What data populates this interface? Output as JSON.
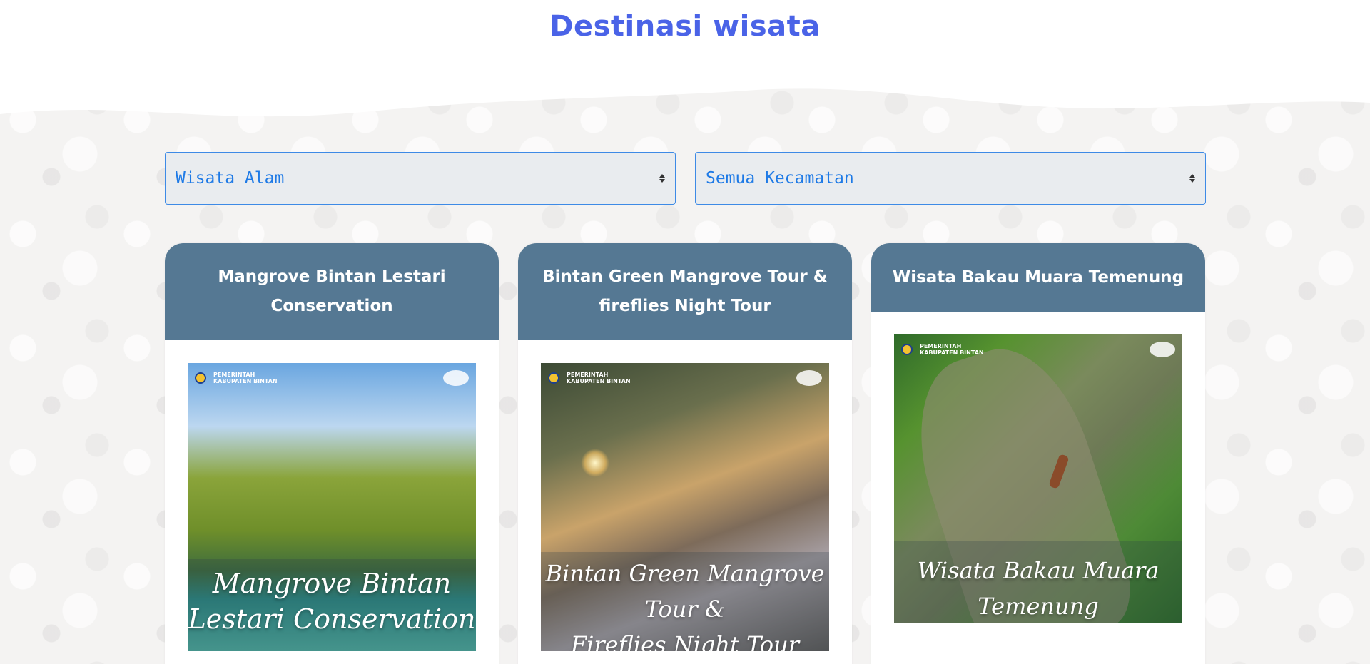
{
  "page": {
    "title": "Destinasi wisata"
  },
  "filters": {
    "category": {
      "selected": "Wisata Alam"
    },
    "district": {
      "selected": "Semua Kecamatan"
    }
  },
  "logo_strip": {
    "org_line1": "PEMERINTAH",
    "org_line2": "KABUPATEN BINTAN"
  },
  "cards": [
    {
      "title": "Mangrove Bintan Lestari Conservation",
      "image_caption_line1": "Mangrove Bintan",
      "image_caption_line2": "Lestari Conservation"
    },
    {
      "title": "Bintan Green Mangrove Tour & fireflies Night Tour",
      "image_caption_line1": "Bintan Green Mangrove Tour &",
      "image_caption_line2": "Fireflies Night Tour"
    },
    {
      "title": "Wisata Bakau Muara Temenung",
      "image_caption_line1": "Wisata Bakau Muara Temenung"
    }
  ],
  "colors": {
    "title": "#4a63e7",
    "card_header": "#557893",
    "select_border": "#3d8ae6",
    "select_text": "#1e7ae6"
  },
  "icons": {
    "select_arrows": "chevron-up-down-icon",
    "government_seal": "seal-icon",
    "tourism_brand": "brand-logo-icon"
  }
}
